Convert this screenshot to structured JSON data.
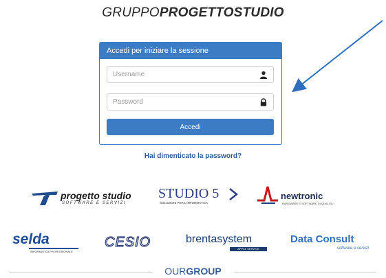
{
  "brand": {
    "light": "GRUPPO",
    "bold": "PROGETTOSTUDIO"
  },
  "login": {
    "heading": "Accedi per iniziare la sessione",
    "username_placeholder": "Username",
    "password_placeholder": "Password",
    "submit_label": "Accedi",
    "forgot_label": "Hai dimenticato la password?"
  },
  "logos": {
    "progetto_studio": {
      "main": "progetto studio",
      "sub": "SOFTWARE E SERVIZI"
    },
    "studio5": {
      "main": "STUDIO 5",
      "sub": "SOLUZIONI PER L'INFORMATICA"
    },
    "newtronic": {
      "main": "newtronic",
      "sub": "HARDWARE E SOFTWARE DI QUALITA'"
    },
    "selda": {
      "main": "selda",
      "sub": "INFORMATICA PROFESSIONALE"
    },
    "cesio": {
      "main": "CESIO"
    },
    "brentasystem": {
      "main": "brentasystem",
      "sub": "APPLE SERVICE"
    },
    "data_consult": {
      "main": "Data Consult",
      "sub": "software e servizi"
    }
  },
  "footer": {
    "light": "OUR",
    "bold": "GROUP"
  },
  "colors": {
    "primary": "#3c7cc4",
    "link": "#2d5b9a",
    "arrow": "#2e6fc0"
  },
  "icons": {
    "username": "user-icon",
    "password": "lock-icon"
  }
}
